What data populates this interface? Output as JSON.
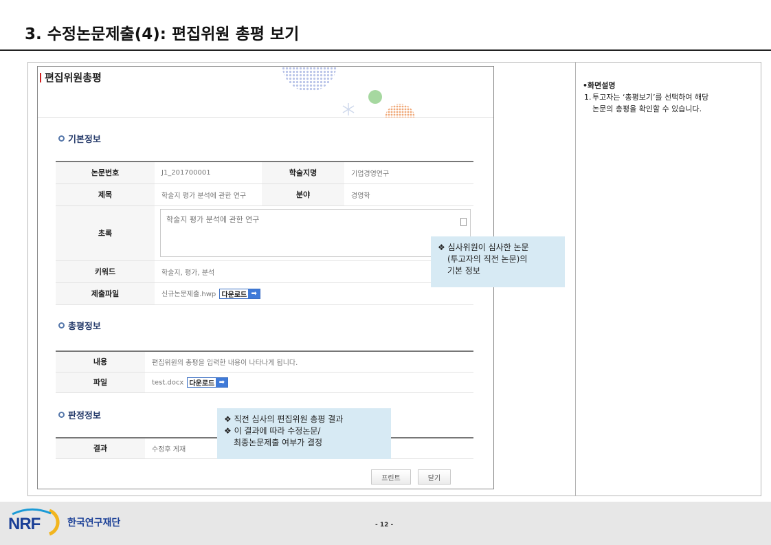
{
  "slide": {
    "title": "3. 수정논문제출(4): 편집위원 총평 보기"
  },
  "description": {
    "heading": "•화면설명",
    "items": [
      {
        "num": "1.",
        "line1": "투고자는 ‘총평보기’를 선택하여 해당",
        "line2": "논문의 총평을 확인할 수 있습니다."
      }
    ]
  },
  "popup": {
    "title": "편집위원총평",
    "basic_section": "기본정보",
    "basic": {
      "paper_no_label": "논문번호",
      "paper_no_value": "J1_201700001",
      "journal_label": "학술지명",
      "journal_value": "기업경영연구",
      "title_label": "제목",
      "title_value": "학술지 평가 분석에 관한 연구",
      "field_label": "분야",
      "field_value": "경영학",
      "abstract_label": "초록",
      "abstract_value": "학술지 평가 분석에 관한 연구",
      "keyword_label": "키워드",
      "keyword_value": "학술지, 평가, 분석",
      "file_label": "제출파일",
      "file_value": "신규논문제출.hwp",
      "download_label": "다운로드"
    },
    "review_section": "총평정보",
    "review": {
      "content_label": "내용",
      "content_value": "편집위원의 총평을 입력한 내용이 나타나게 됩니다.",
      "file_label": "파일",
      "file_value": "test.docx",
      "download_label": "다운로드"
    },
    "decision_section": "판정정보",
    "decision": {
      "result_label": "결과",
      "result_value": "수정후 게재"
    },
    "print_label": "프린트",
    "close_label": "닫기"
  },
  "callouts": {
    "basic": [
      "❖ 심사위원이 심사한 논문",
      "(투고자의 직전 논문)의",
      "기본 정보"
    ],
    "decision": [
      "❖ 직전 심사의 편집위원 총평 결과",
      "❖ 이 결과에 따라 수정논문/",
      "최종논문제출 여부가 결정"
    ]
  },
  "footer": {
    "logo": "NRF",
    "org": "한국연구재단",
    "page": "- 12 -"
  },
  "colors": {
    "callout_bg": "#d7eaf4",
    "section_title": "#253a6a",
    "brand_blue": "#1a3f96",
    "download_blue": "#3f7ad8"
  },
  "icons": {
    "download_arrow": "arrow-right-icon",
    "section_bullet": "circle-bullet-icon",
    "abstract_scroll": "scrollbar-icon"
  }
}
